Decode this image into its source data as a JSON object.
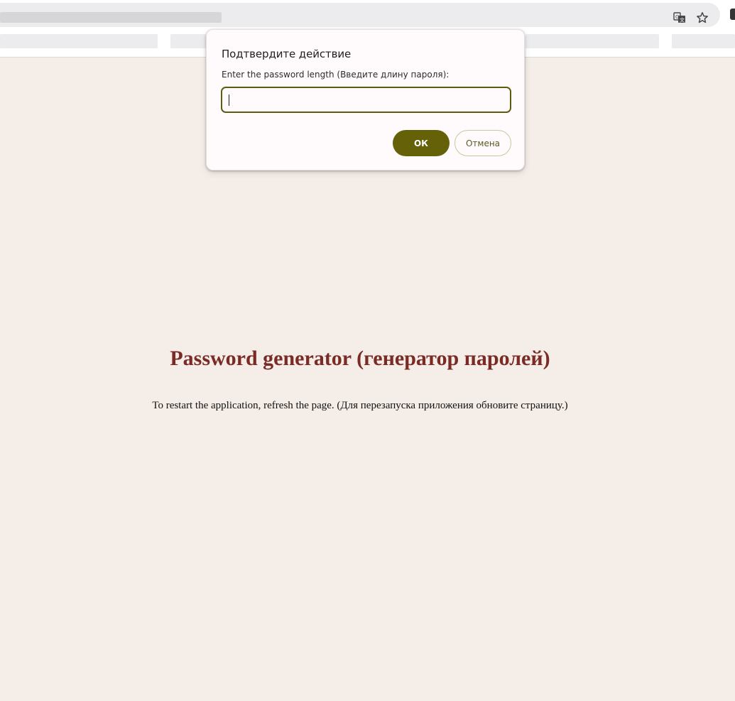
{
  "dialog": {
    "title": "Подтвердите действие",
    "message": "Enter the password length (Введите длину пароля):",
    "input_value": "",
    "ok_label": "ОК",
    "cancel_label": "Отмена"
  },
  "page": {
    "heading": "Password generator (генератор паролей)",
    "note": "To restart the application, refresh the page. (Для перезапуска приложения обновите страницу.)"
  },
  "browser": {
    "icons": [
      "translate-icon",
      "bookmark-star-icon"
    ]
  },
  "colors": {
    "page_background": "#f5ede7",
    "heading": "#7a2b25",
    "accent": "#646108"
  }
}
